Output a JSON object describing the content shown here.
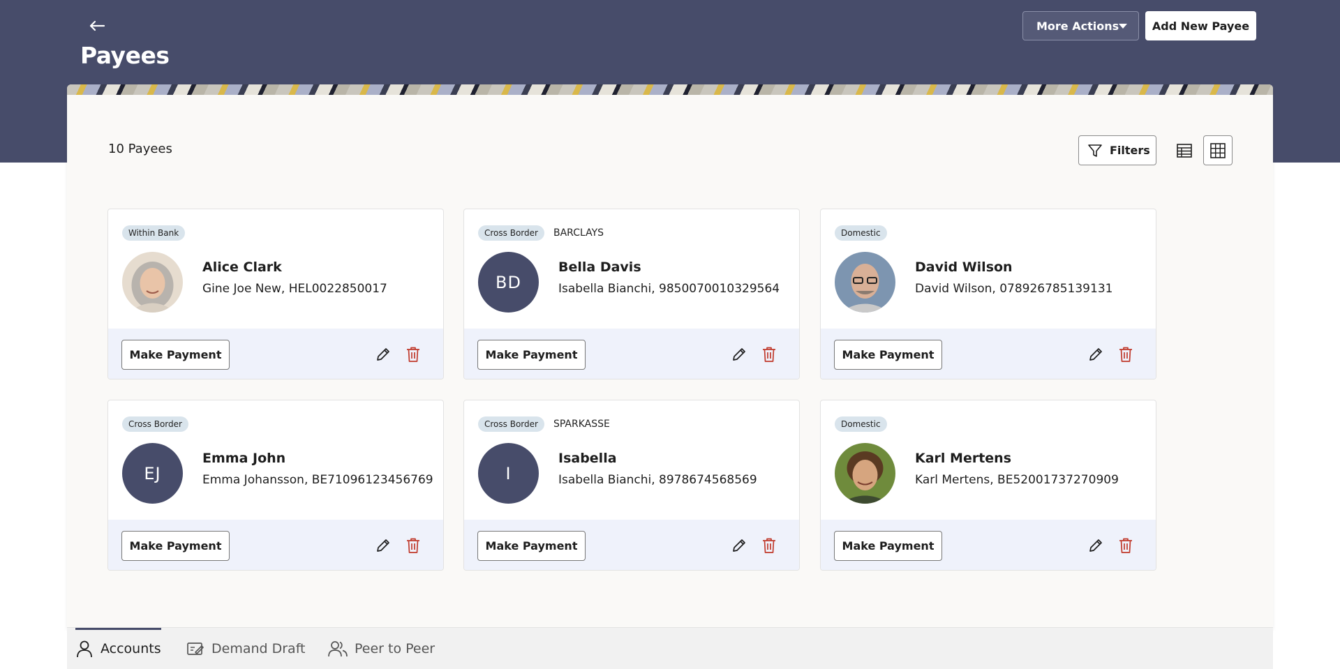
{
  "header": {
    "title": "Payees",
    "more_actions_label": "More Actions",
    "add_payee_label": "Add New Payee"
  },
  "toolbar": {
    "count_label": "10 Payees",
    "filters_label": "Filters"
  },
  "colors": {
    "header_bg": "#474c6a",
    "avatar_bg": "#474c6a",
    "card_footer_bg": "#eff2fb",
    "delete_red": "#c0392b"
  },
  "payees": [
    {
      "tag": "Within Bank",
      "bank": "",
      "name": "Alice Clark",
      "detail": "Gine Joe New, HEL0022850017",
      "avatar": "photo",
      "initials": "",
      "pay_label": "Make Payment"
    },
    {
      "tag": "Cross Border",
      "bank": "BARCLAYS",
      "name": "Bella Davis",
      "detail": "Isabella Bianchi, 9850070010329564",
      "avatar": "initials",
      "initials": "BD",
      "pay_label": "Make Payment"
    },
    {
      "tag": "Domestic",
      "bank": "",
      "name": "David Wilson",
      "detail": "David Wilson, 078926785139131",
      "avatar": "photo",
      "initials": "",
      "pay_label": "Make Payment"
    },
    {
      "tag": "Cross Border",
      "bank": "",
      "name": "Emma John",
      "detail": "Emma Johansson, BE71096123456769",
      "avatar": "initials",
      "initials": "EJ",
      "pay_label": "Make Payment"
    },
    {
      "tag": "Cross Border",
      "bank": "SPARKASSE",
      "name": "Isabella",
      "detail": "Isabella Bianchi, 8978674568569",
      "avatar": "initials",
      "initials": "I",
      "pay_label": "Make Payment"
    },
    {
      "tag": "Domestic",
      "bank": "",
      "name": "Karl Mertens",
      "detail": "Karl Mertens, BE52001737270909",
      "avatar": "photo",
      "initials": "",
      "pay_label": "Make Payment"
    }
  ],
  "bottom_nav": {
    "tabs": [
      {
        "label": "Accounts",
        "icon": "person-icon"
      },
      {
        "label": "Demand Draft",
        "icon": "draft-icon"
      },
      {
        "label": "Peer to Peer",
        "icon": "people-icon"
      }
    ]
  }
}
